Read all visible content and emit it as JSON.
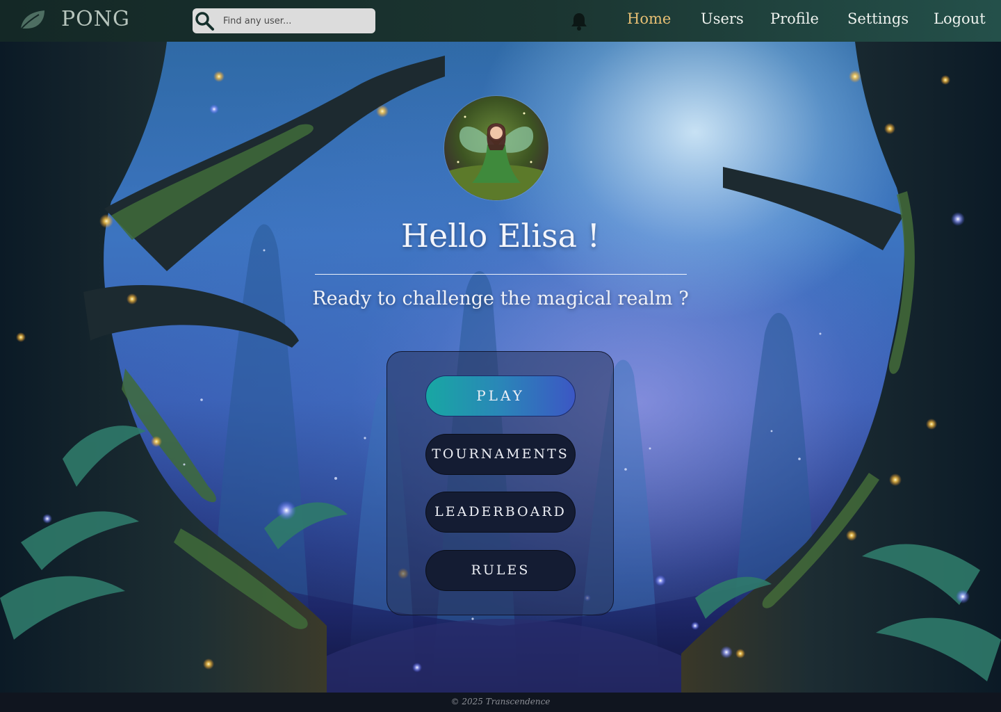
{
  "header": {
    "brand": "PONG",
    "search": {
      "placeholder": "Find any user..."
    },
    "nav": [
      {
        "label": "Home",
        "active": true
      },
      {
        "label": "Users",
        "active": false
      },
      {
        "label": "Profile",
        "active": false
      },
      {
        "label": "Settings",
        "active": false
      },
      {
        "label": "Logout",
        "active": false
      }
    ],
    "icons": {
      "logo": "leaf-icon",
      "search": "search-icon",
      "notifications": "bell-icon"
    }
  },
  "hero": {
    "greeting": "Hello Elisa !",
    "subtitle": "Ready to challenge the magical realm ?",
    "avatar": "fairy-avatar"
  },
  "menu": {
    "play": "PLAY",
    "tournaments": "TOURNAMENTS",
    "leaderboard": "LEADERBOARD",
    "rules": "RULES"
  },
  "footer": {
    "text": "© 2025 Transcendence"
  },
  "colors": {
    "header_start": "#142826",
    "header_end": "#24504a",
    "nav_active": "#e8c074",
    "play_gradient_start": "#18a7a3",
    "play_gradient_end": "#3c57c4",
    "menu_button": "#141c33",
    "footer_bg": "#10151f"
  }
}
